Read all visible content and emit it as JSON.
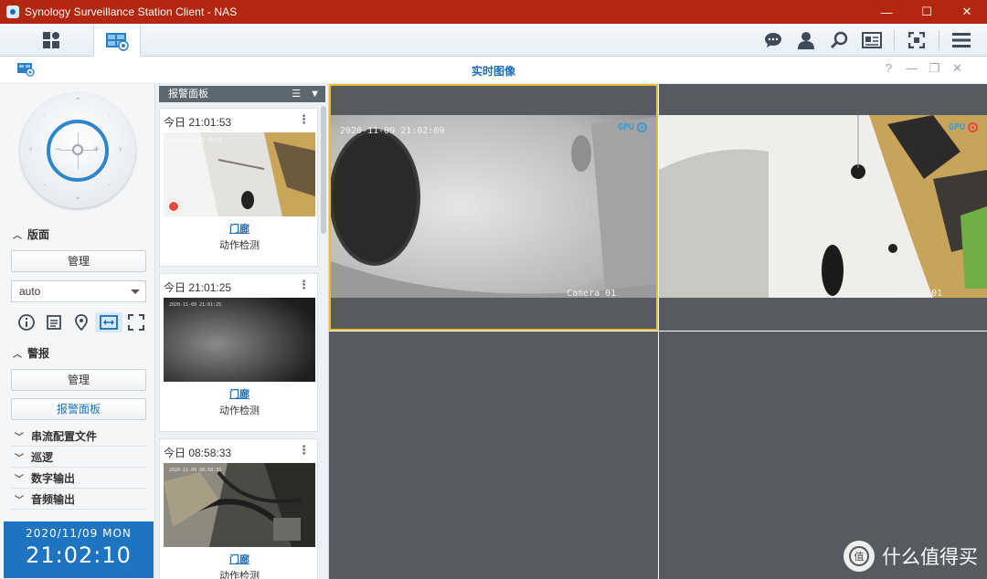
{
  "window": {
    "title": "Synology Surveillance Station Client - NAS",
    "controls": {
      "minimize": "—",
      "maximize": "☐",
      "close": "✕"
    }
  },
  "toolbar": {
    "tabs": [
      {
        "icon": "main-menu-grid-icon"
      },
      {
        "icon": "live-view-icon",
        "active": true
      }
    ],
    "right_icons": [
      "chat-icon",
      "user-icon",
      "search-icon",
      "info-card-icon",
      "fullscreen-icon",
      "hamburger-menu-icon"
    ]
  },
  "live_window": {
    "title": "实时图像",
    "controls": {
      "help": "?",
      "minimize": "—",
      "restore": "❐",
      "close": "✕"
    }
  },
  "left_panel": {
    "layout_section": "版面",
    "layout_manage_button": "管理",
    "layout_select_value": "auto",
    "icon_bar": [
      "info-icon",
      "list-icon",
      "location-pin-icon",
      "fit-width-icon",
      "expand-icon"
    ],
    "alarm_section": "警报",
    "alarm_manage_button": "管理",
    "alarm_panel_button": "报警面板",
    "collapsed_sections": [
      "串流配置文件",
      "巡逻",
      "数字输出",
      "音频输出"
    ],
    "clock": {
      "date": "2020/11/09 MON",
      "time": "21:02:10"
    }
  },
  "alarm_panel": {
    "title": "报警面板",
    "cards": [
      {
        "time": "今日 21:01:53",
        "location": "门廊",
        "event": "动作检测",
        "thumb_osd": "2020-11-09 21:01:53",
        "recording": true
      },
      {
        "time": "今日 21:01:25",
        "location": "门廊",
        "event": "动作检测",
        "thumb_osd": "2020-11-09 21:01:25",
        "recording": false
      },
      {
        "time": "今日 08:58:33",
        "location": "门廊",
        "event": "动作检测",
        "thumb_osd": "2020-11-09 08:58:33",
        "recording": false
      }
    ]
  },
  "video_grid": {
    "cells": [
      {
        "timestamp": "2020-11-09 21:02:09",
        "camera": "Camera 01",
        "gpu_label": "GPU",
        "gpu_state_color": "#3a9ad9",
        "selected": true
      },
      {
        "timestamp": "2020-11-09 21:02:09",
        "camera": "Camera 01",
        "gpu_label": "GPU",
        "gpu_state_color": "#e34b3c",
        "selected": false
      }
    ]
  },
  "watermark": {
    "text": "什么值得买"
  },
  "colors": {
    "titlebar": "#b3260f",
    "accent": "#1a6fbd",
    "selection": "#e6bd2f",
    "clock_bg": "#1e74c0"
  }
}
